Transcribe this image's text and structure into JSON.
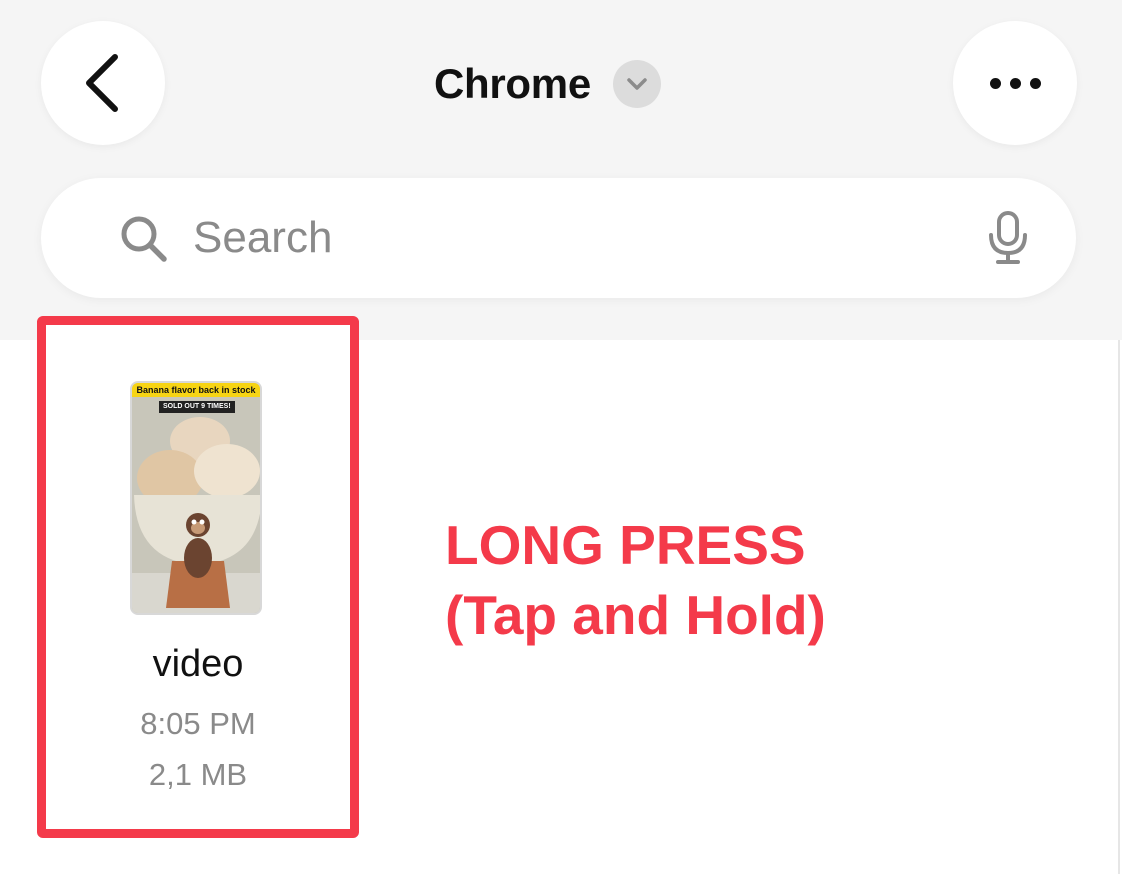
{
  "header": {
    "title": "Chrome"
  },
  "search": {
    "placeholder": "Search"
  },
  "file": {
    "name": "video",
    "time": "8:05 PM",
    "size": "2,1 MB",
    "thumbnail": {
      "banner": "Banana flavor back in stock",
      "badge": "SOLD OUT 9 TIMES!"
    }
  },
  "annotation": {
    "line1": "LONG PRESS",
    "line2": "(Tap and Hold)"
  },
  "colors": {
    "highlight": "#f43a4a",
    "header_bg": "#f5f5f5"
  },
  "icons": [
    "back-chevron-icon",
    "chevron-down-icon",
    "more-icon",
    "search-icon",
    "microphone-icon"
  ]
}
